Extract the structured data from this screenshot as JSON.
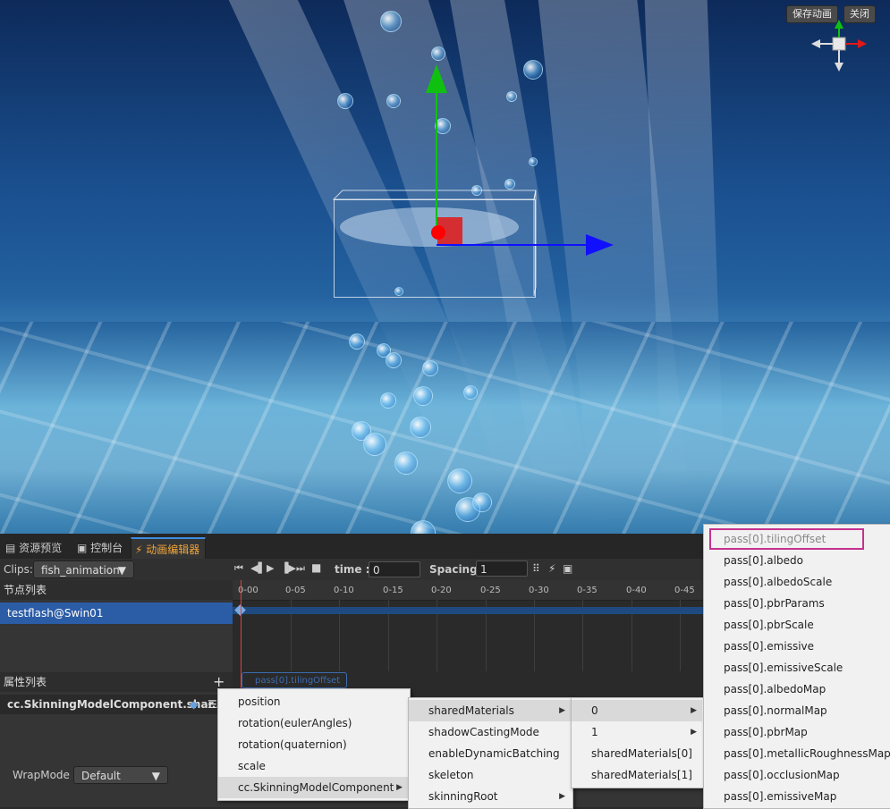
{
  "scene": {
    "save_anim_label": "保存动画",
    "close_label": "关闭"
  },
  "tabs": [
    {
      "label": "资源预览",
      "icon": "folder-icon"
    },
    {
      "label": "控制台",
      "icon": "console-icon"
    },
    {
      "label": "动画编辑器",
      "icon": "animation-icon"
    }
  ],
  "toolbar": {
    "clips_label": "Clips:",
    "clip_value": "fish_animation",
    "time_label": "time :",
    "time_value": "0",
    "spacing_label": "Spacing:",
    "spacing_value": "1"
  },
  "nodes": {
    "header": "节点列表",
    "items": [
      "testflash@Swin01"
    ]
  },
  "timeline": {
    "ticks": [
      "0-00",
      "0-05",
      "0-10",
      "0-15",
      "0-20",
      "0-25",
      "0-30",
      "0-35",
      "0-40",
      "0-45"
    ]
  },
  "props": {
    "header": "属性列表",
    "add_symbol": "+",
    "item": "cc.SkinningModelComponent.shar...",
    "tooltip": "pass[0].tilingOffset"
  },
  "wrap": {
    "label": "WrapMode",
    "value": "Default"
  },
  "menu1": [
    "position",
    "rotation(eulerAngles)",
    "rotation(quaternion)",
    "scale",
    "cc.SkinningModelComponent"
  ],
  "menu2": [
    "sharedMaterials",
    "shadowCastingMode",
    "enableDynamicBatching",
    "skeleton",
    "skinningRoot"
  ],
  "menu3": [
    "0",
    "1",
    "sharedMaterials[0]",
    "sharedMaterials[1]"
  ],
  "menu4": [
    "pass[0].tilingOffset",
    "pass[0].albedo",
    "pass[0].albedoScale",
    "pass[0].pbrParams",
    "pass[0].pbrScale",
    "pass[0].emissive",
    "pass[0].emissiveScale",
    "pass[0].albedoMap",
    "pass[0].normalMap",
    "pass[0].pbrMap",
    "pass[0].metallicRoughnessMap",
    "pass[0].occlusionMap",
    "pass[0].emissiveMap"
  ],
  "colors": {
    "accent_tab": "#f0a53a",
    "selected_row": "#2b5ca6",
    "highlight_box": "#c6328f",
    "gizmo_x": "#1010ff",
    "gizmo_y": "#10c010",
    "gizmo_z": "#ff1010"
  }
}
